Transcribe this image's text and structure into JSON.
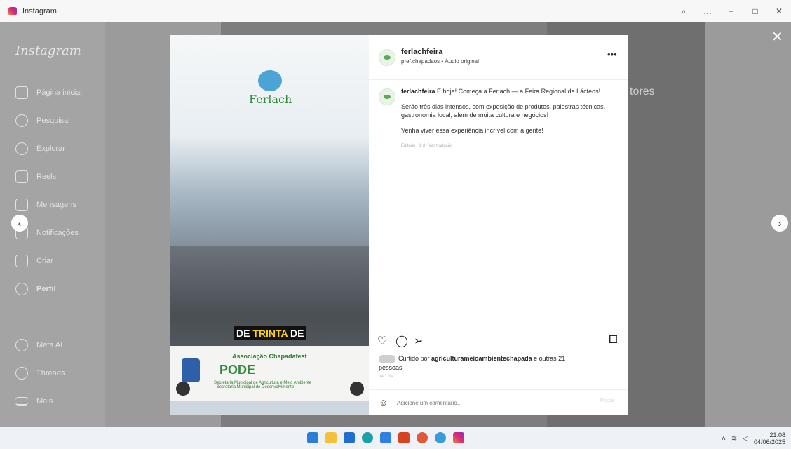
{
  "window": {
    "title": "Instagram",
    "controls": [
      "⌕",
      "…",
      "−",
      "□",
      "✕"
    ]
  },
  "app": {
    "logo": "Instagram",
    "nav": [
      {
        "label": "Página inicial",
        "icon": "home-icon"
      },
      {
        "label": "Pesquisa",
        "icon": "search-icon"
      },
      {
        "label": "Explorar",
        "icon": "compass-icon"
      },
      {
        "label": "Reels",
        "icon": "reels-icon"
      },
      {
        "label": "Mensagens",
        "icon": "messages-icon"
      },
      {
        "label": "Notificações",
        "icon": "heart-icon"
      },
      {
        "label": "Criar",
        "icon": "plus-icon"
      },
      {
        "label": "Perfil",
        "icon": "profile-icon"
      }
    ],
    "nav_bottom": [
      {
        "label": "Meta AI",
        "icon": "meta-ai-icon"
      },
      {
        "label": "Threads",
        "icon": "threads-icon"
      },
      {
        "label": "Mais",
        "icon": "menu-icon"
      }
    ],
    "right_title": "tores"
  },
  "post": {
    "username": "ferlachfeira",
    "subtitle": "pref.chapadaos • Áudio original",
    "more_icon": "•••",
    "caption_user": "ferlachfeira",
    "caption_lines": [
      "É hoje! Começa a Ferlach — a Feira Regional de Lácteos!",
      "Serão três dias intensos, com exposição de produtos, palestras técnicas, gastronomia local, além de muita cultura e negócios!",
      "Venha viver essa experiência incrível com a gente!"
    ],
    "caption_meta": "Editado · 1 d · Ver tradução",
    "liked_by_prefix": "Curtido por ",
    "liked_by_user": "agriculturameioambientechapada",
    "liked_by_suffix": " e outras 21 pessoas",
    "time_ago": "há 1 dia",
    "comment_placeholder": "Adicione um comentário...",
    "post_button": "Postar"
  },
  "media": {
    "brand": "Ferlach",
    "caption_text": "DE ",
    "caption_highlight": "TRINTA",
    "caption_text2": " DE",
    "footer_org": "Associação Chapadafest",
    "footer_pode": "PODE",
    "footer_sec": "Secretaria Municipal de Agricultura e Meio Ambiente · Secretaria Municipal de Desenvolvimento"
  },
  "taskbar": {
    "time": "21:08",
    "date": "04/06/2025"
  },
  "colors": {
    "accent_blue": "#0095f6",
    "instagram_gradient": [
      "#f58529",
      "#dd2a7b",
      "#8134af"
    ]
  }
}
